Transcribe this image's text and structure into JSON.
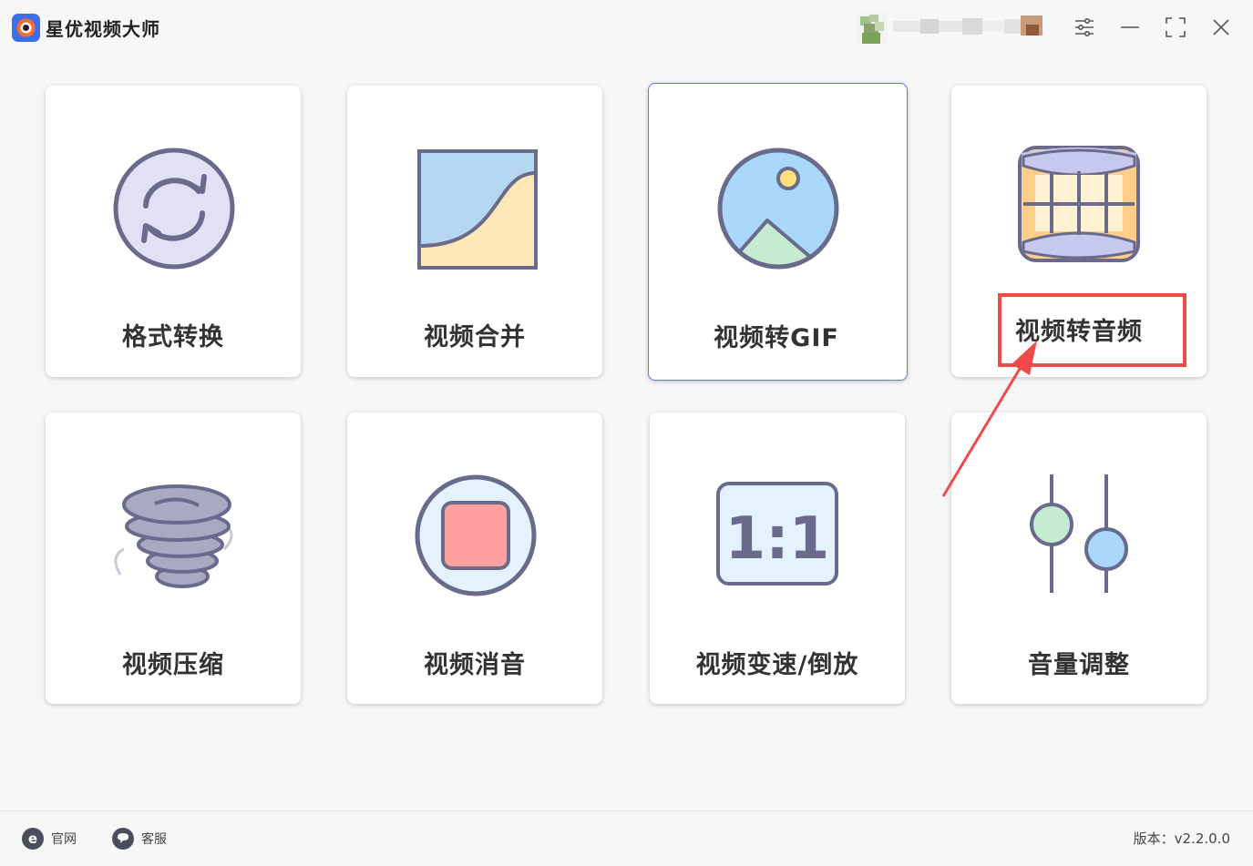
{
  "app": {
    "title": "星优视频大师",
    "logo_icon": "app-logo-icon"
  },
  "window_controls": {
    "settings_icon": "sliders-icon",
    "minimize_icon": "minimize-icon",
    "maximize_icon": "maximize-icon",
    "close_icon": "close-icon"
  },
  "tools": [
    {
      "label": "格式转换",
      "icon": "convert-refresh-icon"
    },
    {
      "label": "视频合并",
      "icon": "merge-curve-icon"
    },
    {
      "label": "视频转GIF",
      "icon": "image-gif-icon"
    },
    {
      "label": "视频转音频",
      "icon": "film-audio-icon"
    },
    {
      "label": "视频压缩",
      "icon": "tornado-compress-icon"
    },
    {
      "label": "视频消音",
      "icon": "stop-mute-icon"
    },
    {
      "label": "视频变速/倒放",
      "icon": "ratio-speed-icon"
    },
    {
      "label": "音量调整",
      "icon": "volume-sliders-icon"
    }
  ],
  "footer": {
    "website_label": "官网",
    "service_label": "客服",
    "version_text": "版本：v2.2.0.0"
  },
  "colors": {
    "accent_border": "#5b7cf0",
    "annotation_red": "#f04a4a",
    "icon_stroke": "#6a6a8c"
  }
}
